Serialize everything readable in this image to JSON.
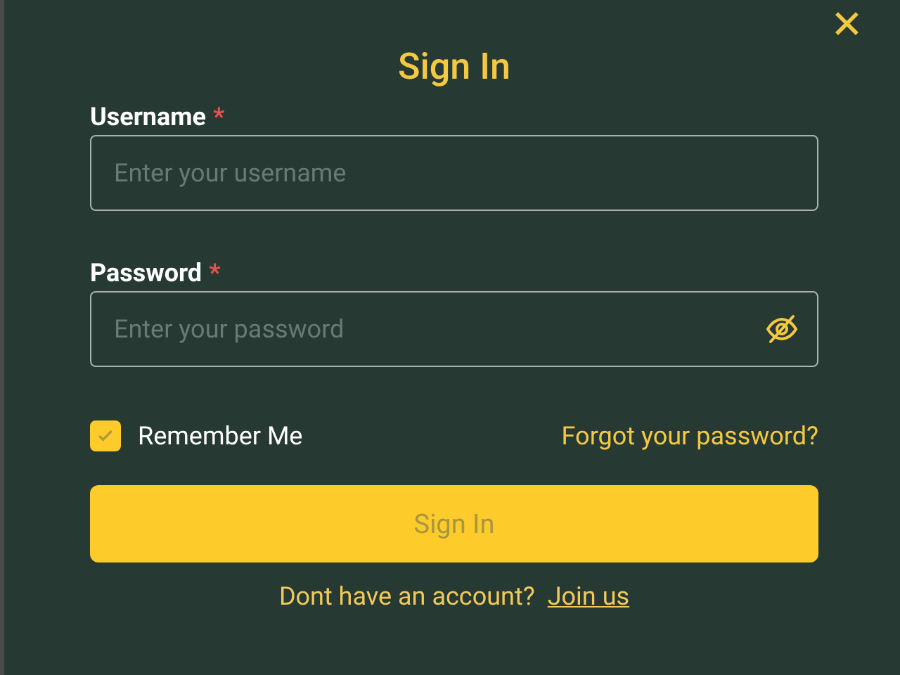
{
  "dialog": {
    "close_icon": "✕",
    "title": "Sign In"
  },
  "fields": [
    {
      "kind": "text",
      "label": "Username",
      "required_mark": "*",
      "placeholder": "Enter your username"
    },
    {
      "kind": "password",
      "label": "Password",
      "required_mark": "*",
      "placeholder": "Enter your password"
    }
  ],
  "remember": {
    "label": "Remember Me",
    "checked": true
  },
  "forgot_link": "Forgot your password?",
  "submit": {
    "label": "Sign In",
    "disabled": true
  },
  "footer": {
    "text": "Dont have an account?",
    "link": "Join us"
  }
}
